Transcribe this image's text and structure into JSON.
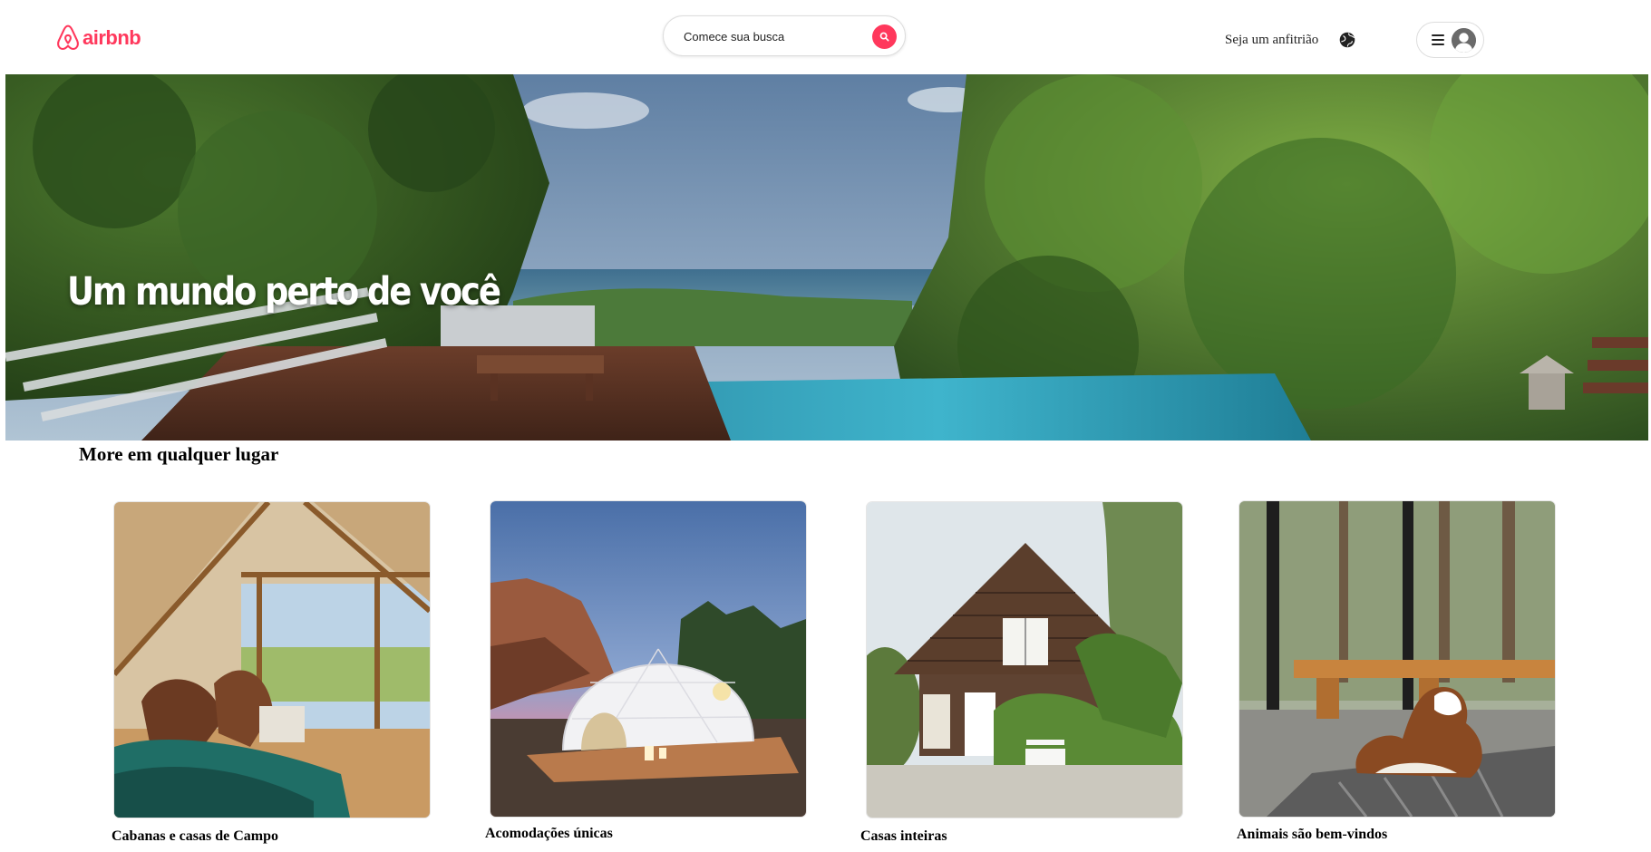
{
  "header": {
    "logo_text": "airbnb",
    "search": {
      "placeholder": "Comece sua busca"
    },
    "host_link": "Seja um anfitrião"
  },
  "hero": {
    "title": "Um mundo perto de você"
  },
  "section": {
    "title": "More em qualquer lugar",
    "cards": [
      {
        "label": "Cabanas e casas de Campo"
      },
      {
        "label": "Acomodações únicas"
      },
      {
        "label": "Casas inteiras"
      },
      {
        "label": "Animais são bem-vindos"
      }
    ]
  },
  "colors": {
    "brand": "#ff385c",
    "text": "#222222",
    "border": "#dddddd"
  },
  "icons": [
    "airbnb-logo-icon",
    "search-icon",
    "globe-icon",
    "menu-icon",
    "user-avatar-icon"
  ]
}
